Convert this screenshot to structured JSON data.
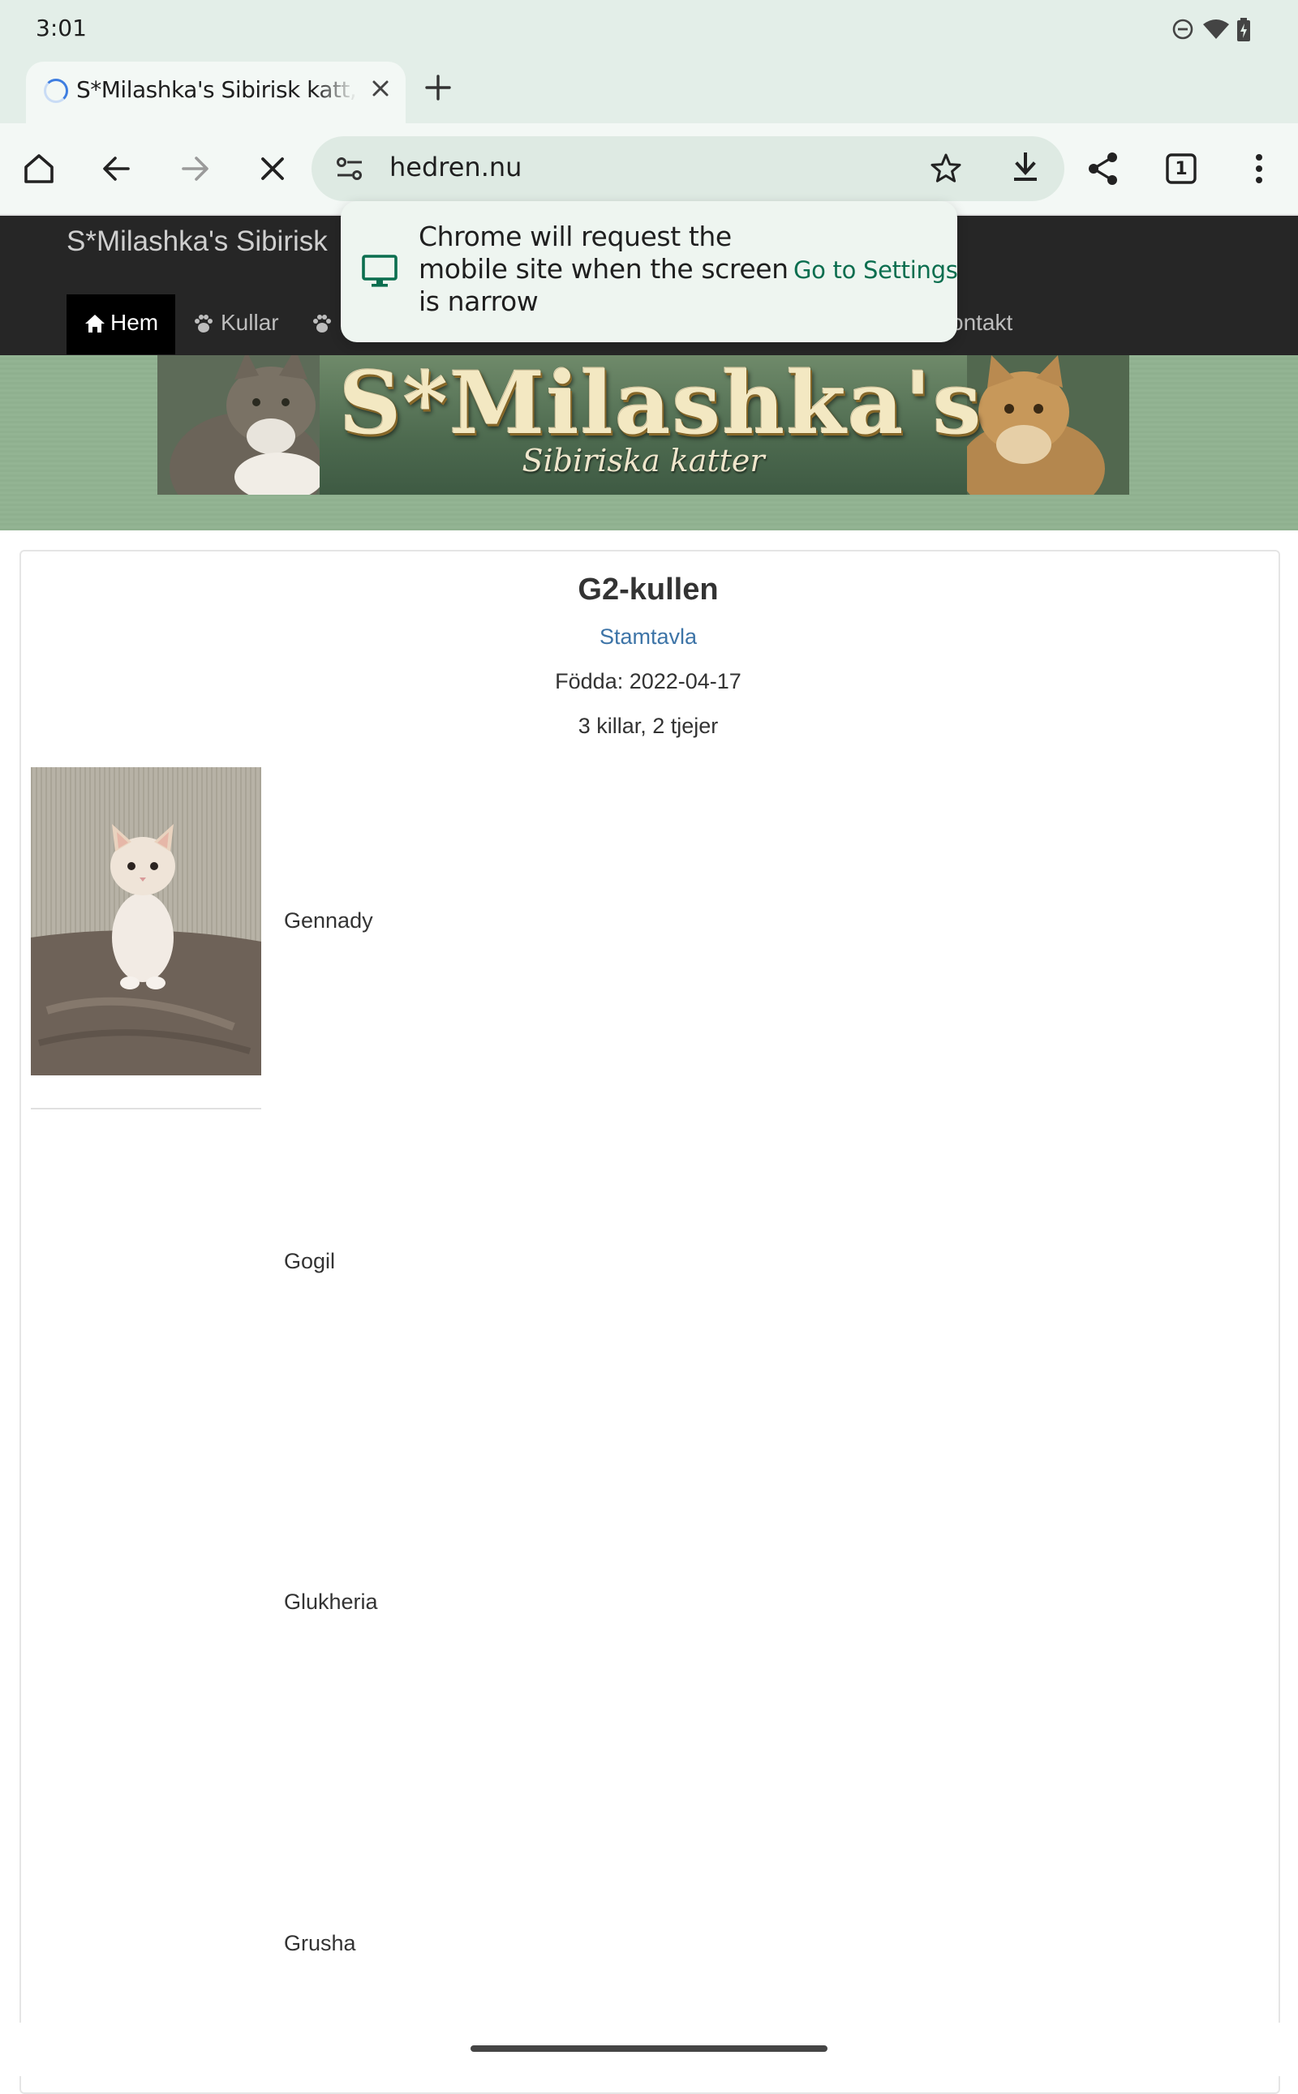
{
  "status_bar": {
    "time": "3:01",
    "icons": [
      "do-not-disturb-icon",
      "wifi-icon",
      "battery-charging-icon"
    ]
  },
  "browser": {
    "tab": {
      "title": "S*Milashka's Sibirisk katt, k"
    },
    "toolbar": {
      "url": "hedren.nu",
      "tab_count": "1",
      "icons": [
        "home-icon",
        "back-arrow-icon",
        "forward-arrow-icon",
        "stop-icon",
        "site-settings-icon",
        "bookmark-star-icon",
        "download-icon",
        "share-icon",
        "tab-switcher-icon",
        "more-vert-icon"
      ]
    },
    "popup": {
      "message": "Chrome will request the mobile site when the screen is narrow",
      "action": "Go to Settings"
    }
  },
  "site": {
    "name": "S*Milashka's Sibirisk",
    "nav": [
      {
        "label": "Hem"
      },
      {
        "label": "Kullar"
      },
      {
        "label": "ontakt"
      }
    ],
    "banner": {
      "title": "S*Milashka's",
      "subtitle": "Sibiriska katter"
    }
  },
  "litter": {
    "title": "G2-kullen",
    "pedigree_link": "Stamtavla",
    "born": "Födda: 2022-04-17",
    "counts": "3 killar, 2 tjejer",
    "kittens": [
      {
        "name": "Gennady"
      },
      {
        "name": "Gogil"
      },
      {
        "name": "Glukheria"
      },
      {
        "name": "Grusha"
      }
    ]
  },
  "colors": {
    "status_bg": "#e3eee8",
    "toolbar_bg": "#f3f8f5",
    "omnibox_bg": "#deeae3",
    "header_bg": "#262626",
    "banner_green": "#8fb08f",
    "link": "#3d74a7",
    "popup_accent": "#0b6e4f"
  }
}
